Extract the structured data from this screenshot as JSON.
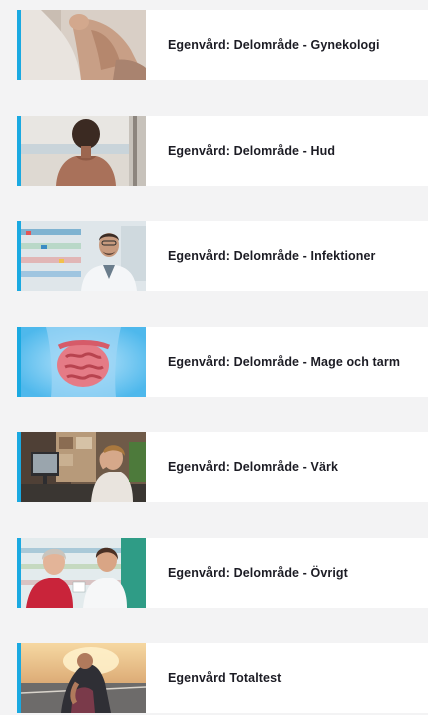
{
  "items": [
    {
      "title": "Egenvård: Delområde - Gynekologi",
      "image": "woman-back-pain-photo"
    },
    {
      "title": "Egenvård: Delområde - Hud",
      "image": "bare-back-woman-photo"
    },
    {
      "title": "Egenvård: Delområde - Infektioner",
      "image": "pharmacist-man-photo"
    },
    {
      "title": "Egenvård: Delområde - Mage och tarm",
      "image": "intestines-illustration"
    },
    {
      "title": "Egenvård: Delområde - Värk",
      "image": "woman-at-desk-photo"
    },
    {
      "title": "Egenvård: Delområde - Övrigt",
      "image": "pharmacist-customer-photo"
    },
    {
      "title": "Egenvård Totaltest",
      "image": "runner-knee-photo"
    }
  ],
  "colors": {
    "accent": "#1aa9e1",
    "background": "#f3f3f4",
    "card": "#ffffff",
    "text": "#1c1c24"
  }
}
